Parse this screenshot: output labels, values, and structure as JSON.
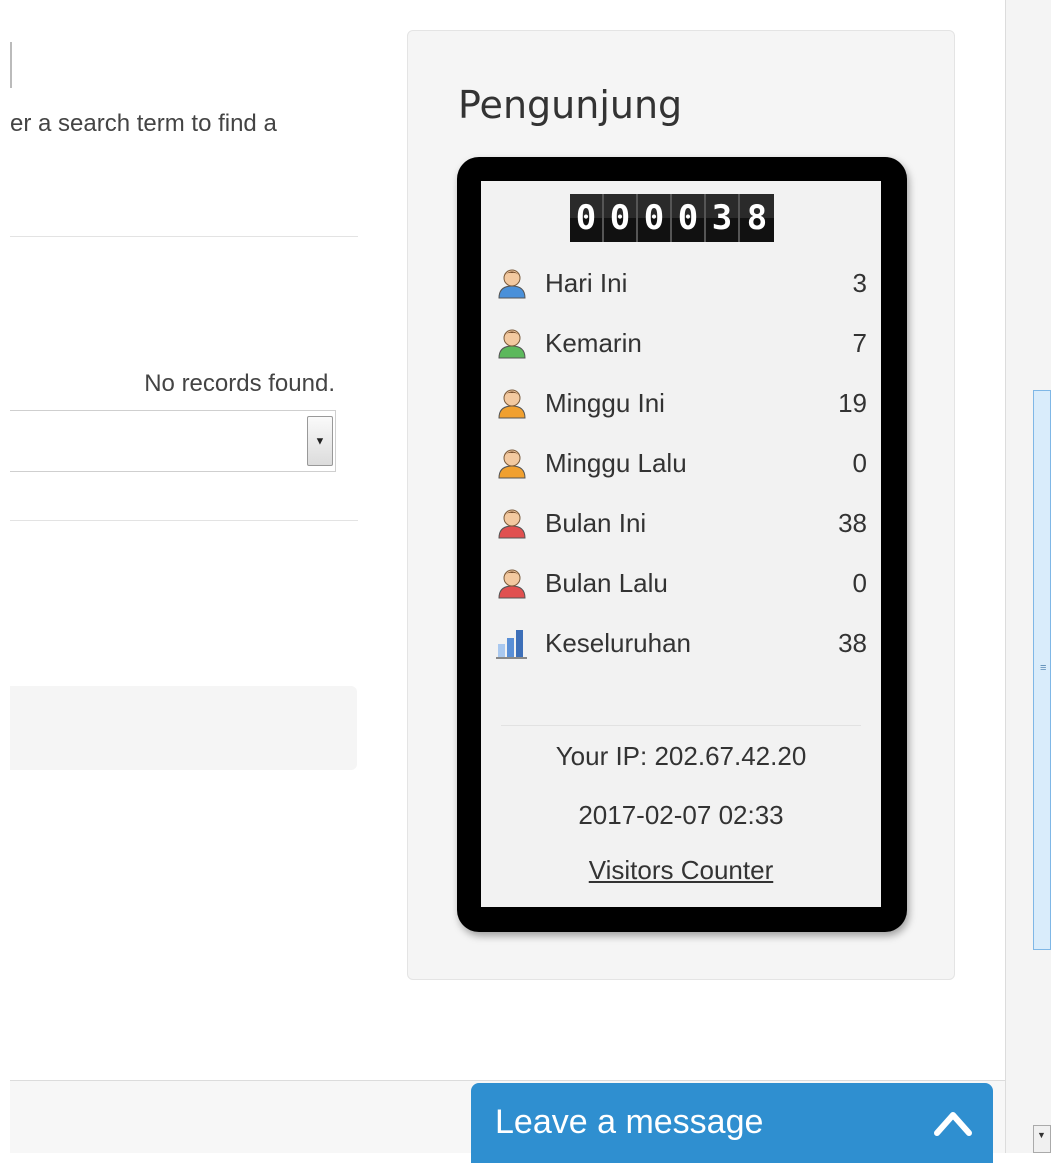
{
  "left": {
    "search_hint": "er a search term to find a",
    "no_records": "No records found."
  },
  "widget": {
    "title": "Pengunjung",
    "counter_digits": [
      "0",
      "0",
      "0",
      "0",
      "3",
      "8"
    ],
    "stats": [
      {
        "label": "Hari Ini",
        "value": "3",
        "icon": "user-blue-icon",
        "color": "#4a90d9"
      },
      {
        "label": "Kemarin",
        "value": "7",
        "icon": "user-green-icon",
        "color": "#5cb85c"
      },
      {
        "label": "Minggu Ini",
        "value": "19",
        "icon": "user-orange-icon",
        "color": "#f0a030"
      },
      {
        "label": "Minggu Lalu",
        "value": "0",
        "icon": "user-orange-icon",
        "color": "#f0a030"
      },
      {
        "label": "Bulan Ini",
        "value": "38",
        "icon": "user-red-icon",
        "color": "#e05050"
      },
      {
        "label": "Bulan Lalu",
        "value": "0",
        "icon": "user-red-icon",
        "color": "#e05050"
      },
      {
        "label": "Keseluruhan",
        "value": "38",
        "icon": "bar-chart-icon",
        "color": "#5a8fd6"
      }
    ],
    "ip_text": "Your IP: 202.67.42.20",
    "datetime": "2017-02-07 02:33",
    "link_text": "Visitors Counter"
  },
  "chat": {
    "label": "Leave a message",
    "color": "#2f8fd0"
  }
}
